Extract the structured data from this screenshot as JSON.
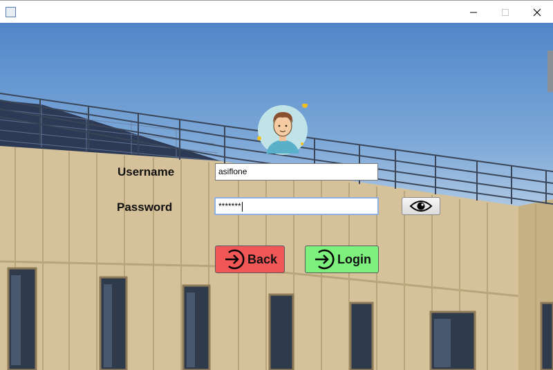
{
  "window": {
    "icons": {
      "app": "java-cup-icon",
      "minimize": "minimize-icon",
      "maximize": "maximize-icon",
      "close": "close-icon"
    }
  },
  "form": {
    "username_label": "Username",
    "password_label": "Password",
    "username_value": "asiflone",
    "password_value": "*******",
    "show_password_icon": "eye-icon",
    "avatar_icon": "user-avatar-icon"
  },
  "buttons": {
    "back_label": "Back",
    "login_label": "Login",
    "back_icon": "arrow-in-circle-icon",
    "login_icon": "login-arrow-icon"
  },
  "colors": {
    "back_button": "#f25757",
    "login_button": "#7ef07e",
    "label_text": "#111111"
  }
}
